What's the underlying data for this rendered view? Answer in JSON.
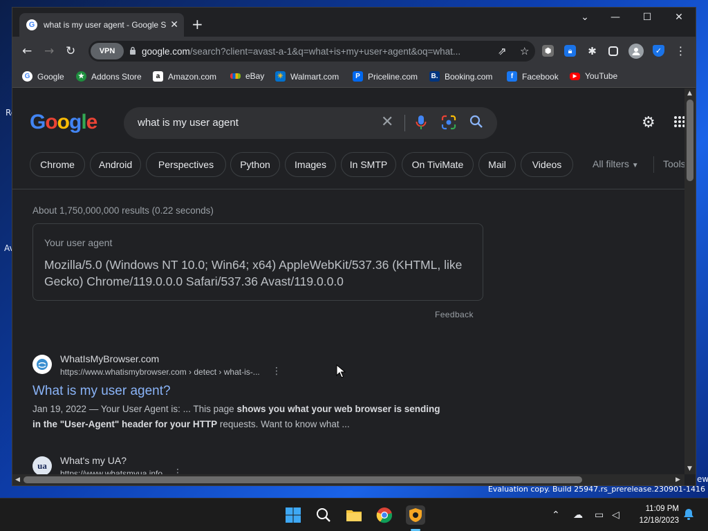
{
  "desktop": {
    "left_text_1": "Re",
    "left_text_2": "Av",
    "right_text": "ew",
    "eval_copy": "Evaluation copy. Build 25947.rs_prerelease.230901-1416"
  },
  "browser": {
    "tab_title": "what is my user agent - Google S",
    "vpn_label": "VPN",
    "url_host": "google.com",
    "url_path": "/search?client=avast-a-1&q=what+is+my+user+agent&oq=what...",
    "bookmarks": [
      {
        "label": "Google",
        "icon": "google-icon",
        "color": "#ffffff"
      },
      {
        "label": "Addons Store",
        "icon": "addons-store-icon",
        "color": "#1e8e3e"
      },
      {
        "label": "Amazon.com",
        "icon": "amazon-icon",
        "color": "#ffffff"
      },
      {
        "label": "eBay",
        "icon": "ebay-icon",
        "color": "#e53238"
      },
      {
        "label": "Walmart.com",
        "icon": "walmart-icon",
        "color": "#0071ce"
      },
      {
        "label": "Priceline.com",
        "icon": "priceline-icon",
        "color": "#0068ef"
      },
      {
        "label": "Booking.com",
        "icon": "booking-icon",
        "color": "#003580"
      },
      {
        "label": "Facebook",
        "icon": "facebook-icon",
        "color": "#1877f2"
      },
      {
        "label": "YouTube",
        "icon": "youtube-icon",
        "color": "#ff0000"
      }
    ]
  },
  "search": {
    "query": "what is my user agent",
    "chips": [
      "Chrome",
      "Android",
      "Perspectives",
      "Python",
      "Images",
      "In SMTP",
      "On TiviMate",
      "Mail",
      "Videos"
    ],
    "all_filters": "All filters",
    "tools": "Tools",
    "stats": "About 1,750,000,000 results (0.22 seconds)",
    "ua_label": "Your user agent",
    "ua_value": "Mozilla/5.0 (Windows NT 10.0; Win64; x64) AppleWebKit/537.36 (KHTML, like Gecko) Chrome/119.0.0.0 Safari/537.36 Avast/119.0.0.0",
    "feedback": "Feedback",
    "results": [
      {
        "site": "WhatIsMyBrowser.com",
        "url": "https://www.whatismybrowser.com › detect › what-is-...",
        "title": "What is my user agent?",
        "snippet_date": "Jan 19, 2022 — Your User Agent is: ... This page ",
        "snippet_bold_1": "shows you what your web browser is sending in the \"User-Agent\" header for your HTTP",
        "snippet_end": " requests. Want to know what ..."
      },
      {
        "site": "What's my UA?",
        "url": "https://www.whatsmyua.info",
        "fav_text": "ua"
      }
    ]
  },
  "taskbar": {
    "time": "11:09 PM",
    "date": "12/18/2023"
  }
}
